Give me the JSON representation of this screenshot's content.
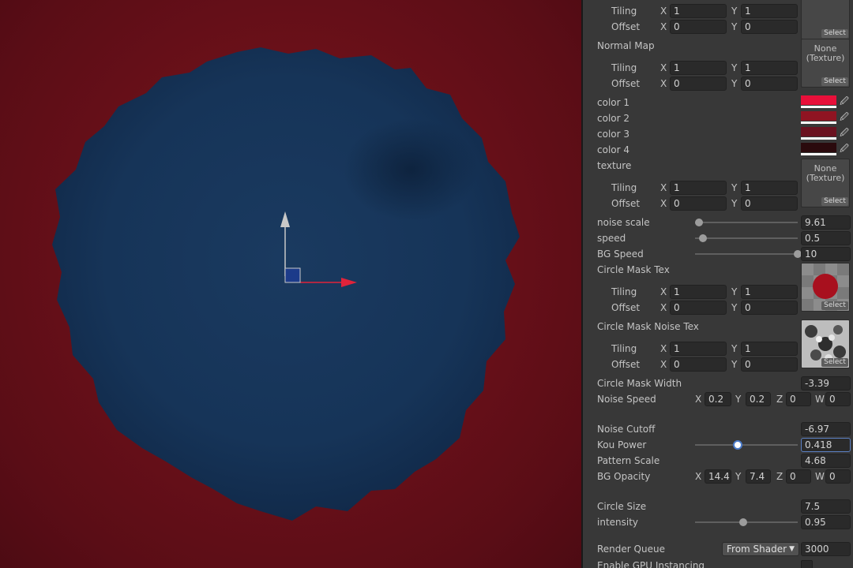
{
  "tex_none_label": "None\n(Texture)",
  "tex_select_label": "Select",
  "tiling_label": "Tiling",
  "offset_label": "Offset",
  "axis": {
    "x": "X",
    "y": "Y",
    "z": "Z",
    "w": "W"
  },
  "top_tex": {
    "tiling_x": "1",
    "tiling_y": "1",
    "offset_x": "0",
    "offset_y": "0"
  },
  "normal_map": {
    "label": "Normal Map",
    "tiling_x": "1",
    "tiling_y": "1",
    "offset_x": "0",
    "offset_y": "0"
  },
  "colors": [
    {
      "label": "color 1",
      "hex": "#e8103a"
    },
    {
      "label": "color 2",
      "hex": "#8f1422"
    },
    {
      "label": "color 3",
      "hex": "#6a1220"
    },
    {
      "label": "color 4",
      "hex": "#2a0a0d"
    }
  ],
  "texture": {
    "label": "texture",
    "tiling_x": "1",
    "tiling_y": "1",
    "offset_x": "0",
    "offset_y": "0"
  },
  "noise_scale": {
    "label": "noise scale",
    "value": "9.61",
    "fraction": 0.04
  },
  "speed": {
    "label": "speed",
    "value": "0.5",
    "fraction": 0.08
  },
  "bg_speed": {
    "label": "BG Speed",
    "value": "10",
    "fraction": 1.0
  },
  "circle_mask_tex": {
    "label": "Circle Mask Tex",
    "tiling_x": "1",
    "tiling_y": "1",
    "offset_x": "0",
    "offset_y": "0"
  },
  "circle_mask_noise_tex": {
    "label": "Circle Mask Noise Tex",
    "tiling_x": "1",
    "tiling_y": "1",
    "offset_x": "0",
    "offset_y": "0"
  },
  "circle_mask_width": {
    "label": "Circle Mask Width",
    "value": "-3.39"
  },
  "noise_speed": {
    "label": "Noise Speed",
    "x": "0.2",
    "y": "0.2",
    "z": "0",
    "w": "0"
  },
  "noise_cutoff": {
    "label": "Noise Cutoff",
    "value": "-6.97"
  },
  "kou_power": {
    "label": "Kou Power",
    "value": "0.418",
    "fraction": 0.418
  },
  "pattern_scale": {
    "label": "Pattern Scale",
    "value": "4.68"
  },
  "bg_opacity": {
    "label": "BG Opacity",
    "x": "14.4",
    "y": "7.4",
    "z": "0",
    "w": "0"
  },
  "circle_size": {
    "label": "Circle Size",
    "value": "7.5"
  },
  "intensity": {
    "label": "intensity",
    "value": "0.95",
    "fraction": 0.47
  },
  "render_queue": {
    "label": "Render Queue",
    "mode": "From Shader",
    "value": "3000"
  },
  "gpu_instancing": {
    "label": "Enable GPU Instancing"
  }
}
